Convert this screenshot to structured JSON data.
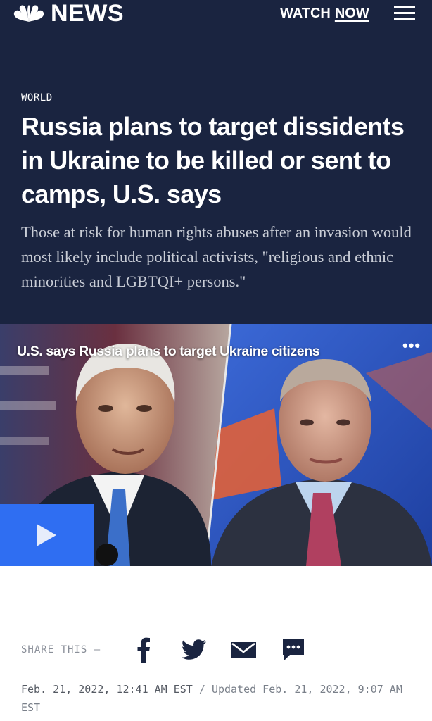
{
  "header": {
    "logo_text": "NEWS",
    "watch_label": "WATCH",
    "now_label": "NOW",
    "menu_icon": "hamburger-icon"
  },
  "article": {
    "section": "WORLD",
    "headline": "Russia plans to target dissidents in Ukraine to be killed or sent to camps, U.S. says",
    "dek": "Those at risk for human rights abuses after an invasion would most likely include political activists, \"religious and ethnic minorities and LGBTQI+ persons.\""
  },
  "video": {
    "title": "U.S. says Russia plans to target Ukraine citizens",
    "more_label": "•••",
    "play_icon": "play-icon"
  },
  "share": {
    "label": "SHARE THIS —",
    "icons": [
      "facebook-icon",
      "twitter-icon",
      "email-icon",
      "sms-icon"
    ]
  },
  "dateline": {
    "published": "Feb. 21, 2022, 12:41 AM EST",
    "separator": " / ",
    "updated": "Updated Feb. 21, 2022, 9:07 AM EST"
  },
  "colors": {
    "header_bg": "#1a2440",
    "accent_blue": "#2f6ef2",
    "text_white": "#ffffff",
    "dek_text": "#c9cdd6",
    "icon_dark": "#1a2440"
  }
}
